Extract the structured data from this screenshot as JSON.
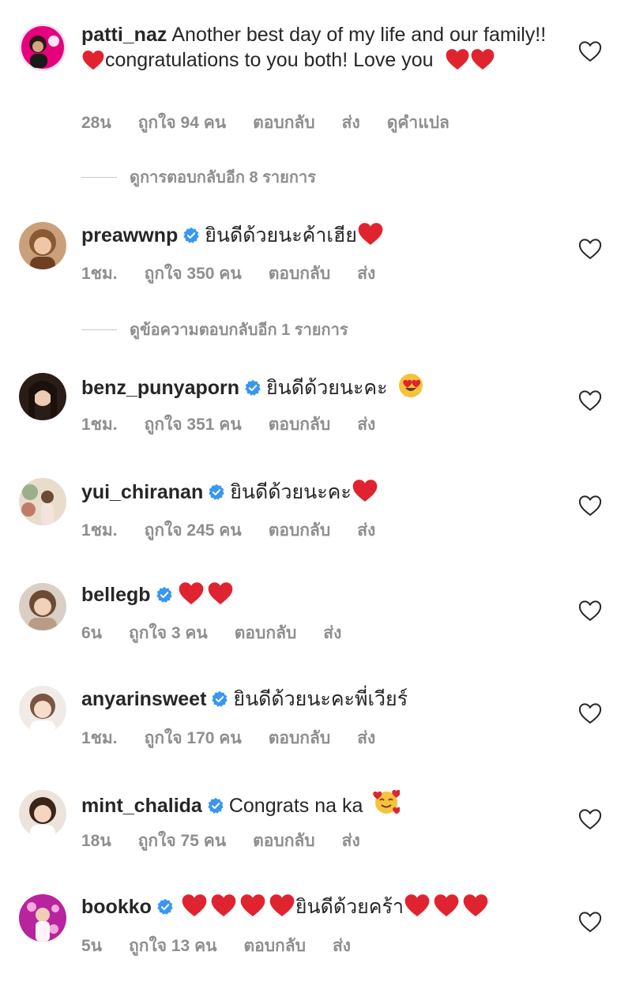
{
  "comments": [
    {
      "username": "patti_naz",
      "verified": false,
      "text_1": "Another best day of my life and our family!!",
      "text_2": "congratulations to you both! Love you",
      "time": "28น",
      "likes": "ถูกใจ 94 คน",
      "reply": "ตอบกลับ",
      "send": "ส่ง",
      "translate": "ดูคำแปล",
      "avatar_color": "#e6007e"
    },
    {
      "username": "preawwnp",
      "verified": true,
      "text": "ยินดีด้วยนะค้าเฮีย",
      "time": "1ชม.",
      "likes": "ถูกใจ 350 คน",
      "reply": "ตอบกลับ",
      "send": "ส่ง",
      "avatar_color": "#a36a45"
    },
    {
      "username": "benz_punyaporn",
      "verified": true,
      "text": "ยินดีด้วยนะคะ",
      "time": "1ชม.",
      "likes": "ถูกใจ 351 คน",
      "reply": "ตอบกลับ",
      "send": "ส่ง",
      "avatar_color": "#3b2a22"
    },
    {
      "username": "yui_chiranan",
      "verified": true,
      "text": "ยินดีด้วยนะคะ",
      "time": "1ชม.",
      "likes": "ถูกใจ 245 คน",
      "reply": "ตอบกลับ",
      "send": "ส่ง",
      "avatar_color": "#c9b49a"
    },
    {
      "username": "bellegb",
      "verified": true,
      "text": "",
      "time": "6น",
      "likes": "ถูกใจ 3 คน",
      "reply": "ตอบกลับ",
      "send": "ส่ง",
      "avatar_color": "#8a6a52"
    },
    {
      "username": "anyarinsweet",
      "verified": true,
      "text": "ยินดีด้วยนะคะพี่เวียร์",
      "time": "1ชม.",
      "likes": "ถูกใจ 170 คน",
      "reply": "ตอบกลับ",
      "send": "ส่ง",
      "avatar_color": "#e3d6cf"
    },
    {
      "username": "mint_chalida",
      "verified": true,
      "text": "Congrats na ka",
      "time": "18น",
      "likes": "ถูกใจ 75 คน",
      "reply": "ตอบกลับ",
      "send": "ส่ง",
      "avatar_color": "#4a3328"
    },
    {
      "username": "bookko",
      "verified": true,
      "text": "ยินดีด้วยคร้า",
      "time": "5น",
      "likes": "ถูกใจ 13 คน",
      "reply": "ตอบกลับ",
      "send": "ส่ง",
      "avatar_color": "#b02a9a"
    }
  ],
  "view_replies": [
    "ดูการตอบกลับอีก 8 รายการ",
    "ดูข้อความตอบกลับอีก 1 รายการ"
  ],
  "colors": {
    "heart": "#e0242f",
    "verified": "#3897f0",
    "meta": "#8e8e8e",
    "text": "#262626"
  },
  "icons": [
    "heart-outline-icon",
    "verified-badge-icon",
    "heart-emoji",
    "heart-eyes-emoji",
    "smiling-face-hearts-emoji"
  ]
}
